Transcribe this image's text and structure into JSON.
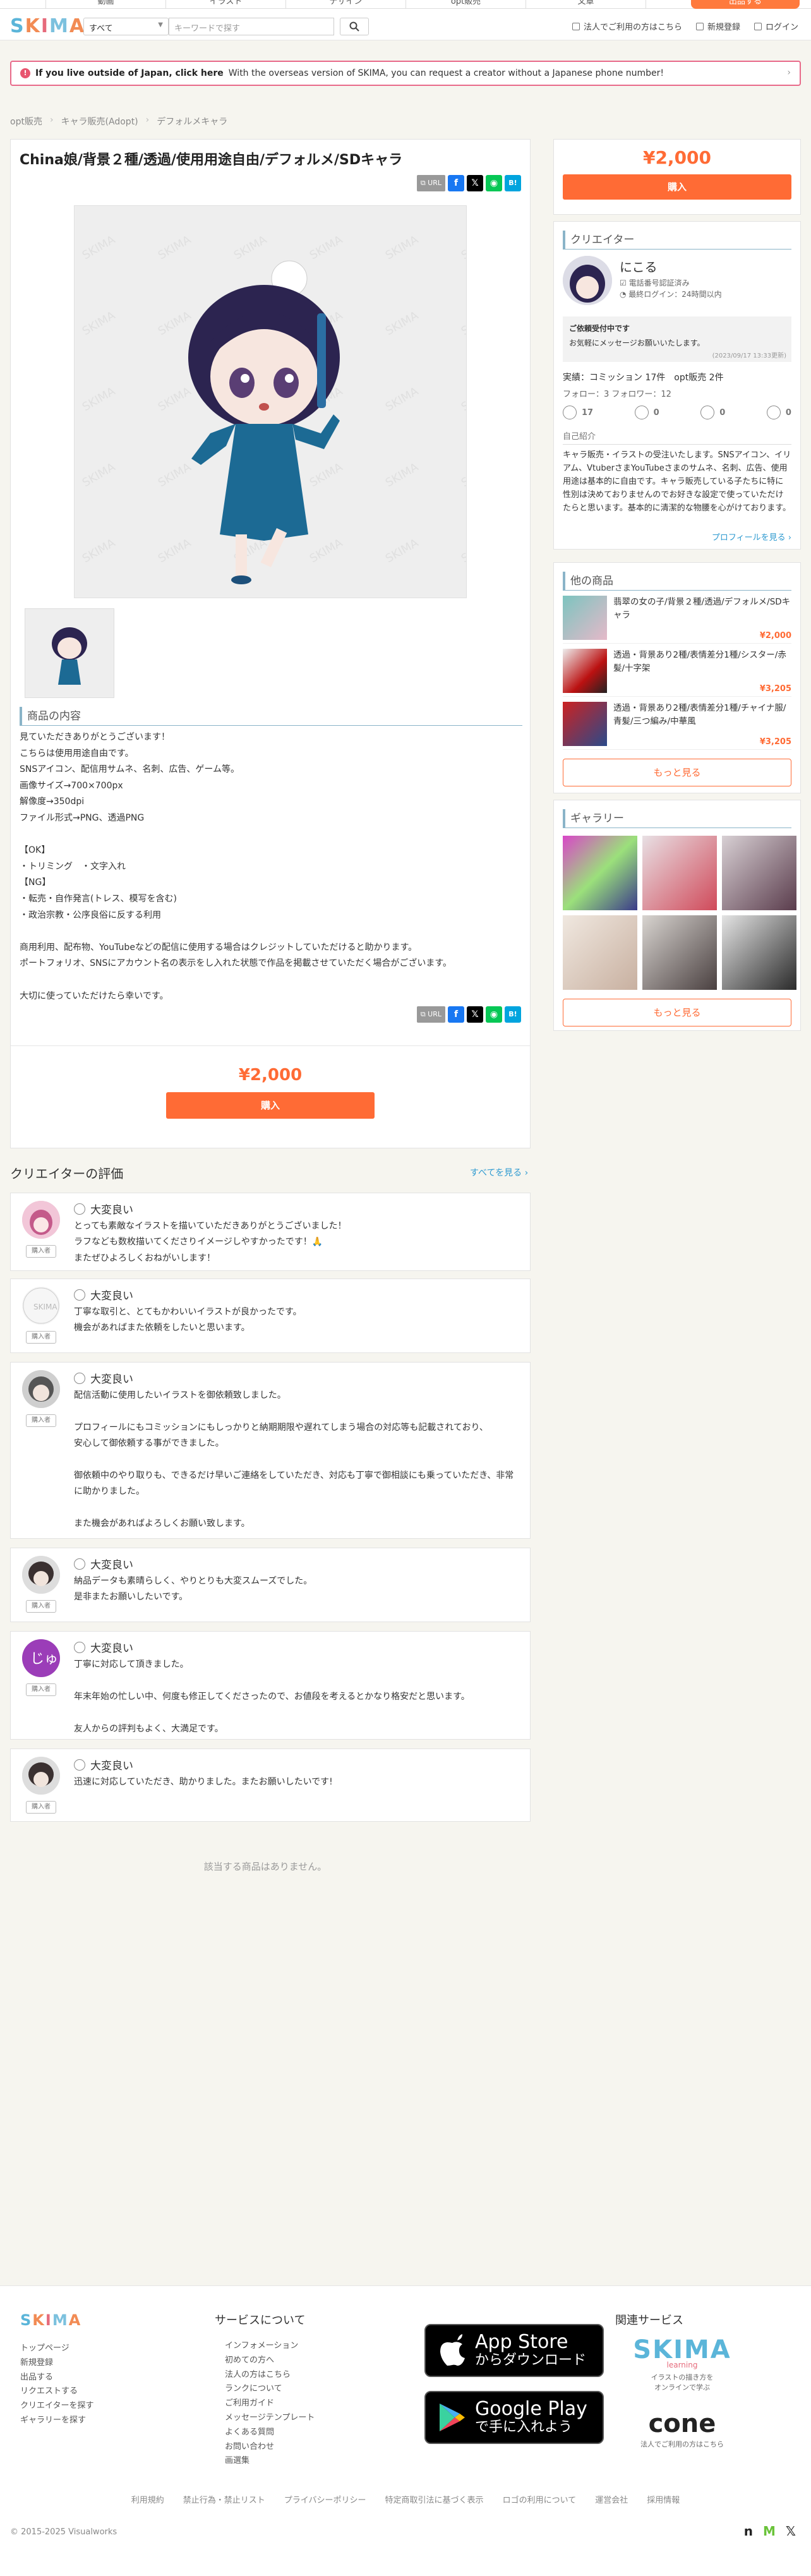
{
  "topnav": {
    "items": [
      "動画",
      "イラスト",
      "デザイン",
      "opt販売",
      "文章",
      "その他"
    ],
    "sell": "出品する"
  },
  "header": {
    "logo": [
      "S",
      "K",
      "I",
      "M",
      "A"
    ],
    "category": "すべて",
    "search_placeholder": "キーワードで探す",
    "links": [
      "法人でご利用の方はこちら",
      "新規登録",
      "ログイン"
    ]
  },
  "alert": {
    "strong": "If you live outside of Japan, click here",
    "text": "With the overseas version of SKIMA, you can request a creator without a Japanese phone number!"
  },
  "breadcrumb": [
    "opt販売",
    "キャラ販売(Adopt)",
    "デフォルメキャラ"
  ],
  "product": {
    "title": "China娘/背景２種/透過/使用用途自由/デフォルメ/SDキャラ",
    "url_label": "URL",
    "content_heading": "商品の内容",
    "description": [
      "見ていただきありがとうございます！",
      "こちらは使用用途自由です。",
      "SNSアイコン、配信用サムネ、名刺、広告、ゲーム等。",
      "画像サイズ→700×700px",
      "解像度→350dpi",
      "ファイル形式→PNG、透過PNG",
      "",
      "【OK】",
      "・トリミング　・文字入れ",
      "【NG】",
      "・転売・自作発言(トレス、模写を含む)",
      "・政治宗教・公序良俗に反する利用",
      "",
      "商用利用、配布物、YouTubeなどの配信に使用する場合はクレジットしていただけると助かります。",
      "ポートフォリオ、SNSにアカウント名の表示をし入れた状態で作品を掲載させていただく場合がございます。",
      "",
      "大切に使っていただけたら幸いです。"
    ],
    "price": "¥2,000",
    "buy": "購入"
  },
  "creator": {
    "heading": "クリエイター",
    "name": "にこる",
    "verified": "電話番号認証済み",
    "last_login": "最終ログイン：24時間以内",
    "accepting": "ご依頼受付中です",
    "accepting_msg": "お気軽にメッセージお願いいたします。",
    "updated": "(2023/09/17 13:33更新)",
    "stats": "実績：コミッション 17件　opt販売 2件",
    "follow": "フォロー：3  フォロワー：12",
    "faces": [
      "17",
      "0",
      "0",
      "0"
    ],
    "intro_heading": "自己紹介",
    "intro": "キャラ販売・イラストの受注いたします。SNSアイコン、イリアム、VtuberさまYouTubeさまのサムネ、名刺、広告、使用用途は基本的に自由です。キャラ販売している子たちに特に性別は決めておりませんのでお好きな設定で使っていただけたらと思います。基本的に清潔的な物腰を心がけております。",
    "profile_link": "プロフィールを見る ›"
  },
  "other_items": {
    "heading": "他の商品",
    "items": [
      {
        "title": "翡翠の女の子/背景２種/透過/デフォルメ/SDキャラ",
        "price": "¥2,000"
      },
      {
        "title": "透過・背景あり2種/表情差分1種/シスター/赤髪/十字架",
        "price": "¥3,205"
      },
      {
        "title": "透過・背景あり2種/表情差分1種/チャイナ服/青髪/三つ編み/中華風",
        "price": "¥3,205"
      }
    ],
    "more": "もっと見る"
  },
  "gallery": {
    "heading": "ギャラリー",
    "more": "もっと見る"
  },
  "reviews": {
    "heading": "クリエイターの評価",
    "all": "すべてを見る ›",
    "tag": "購入者",
    "items": [
      {
        "rating": "大変良い",
        "body": [
          "とっても素敵なイラストを描いていただきありがとうございました！",
          "ラフなども数枚描いてくださりイメージしやすかったです！🙏",
          "またぜひよろしくおねがいします！"
        ]
      },
      {
        "rating": "大変良い",
        "body": [
          "丁寧な取引と、とてもかわいいイラストが良かったです。",
          "機会があればまた依頼をしたいと思います。"
        ]
      },
      {
        "rating": "大変良い",
        "body": [
          "配信活動に使用したいイラストを御依頼致しました。",
          "",
          "プロフィールにもコミッションにもしっかりと納期期限や遅れてしまう場合の対応等も記載されており、",
          "安心して御依頼する事ができました。",
          "",
          "御依頼中のやり取りも、できるだけ早いご連絡をしていただき、対応も丁寧で御相談にも乗っていただき、非常に助かりました。",
          "",
          "また機会があればよろしくお願い致します。"
        ]
      },
      {
        "rating": "大変良い",
        "body": [
          "納品データも素晴らしく、やりとりも大変スムーズでした。",
          "是非またお願いしたいです。"
        ]
      },
      {
        "rating": "大変良い",
        "body": [
          "丁寧に対応して頂きました。",
          "",
          "年末年始の忙しい中、何度も修正してくださったので、お値段を考えるとかなり格安だと思います。",
          "",
          "友人からの評判もよく、大満足です。"
        ]
      },
      {
        "rating": "大変良い",
        "body": [
          "迅速に対応していただき、助かりました。またお願いしたいです!"
        ]
      }
    ]
  },
  "related_empty": "該当する商品はありません。",
  "footer": {
    "col1": [
      "トップページ",
      "新規登録",
      "出品する",
      "リクエストする",
      "クリエイターを探す",
      "ギャラリーを探す"
    ],
    "services_heading": "サービスについて",
    "col2": [
      "インフォメーション",
      "初めての方へ",
      "法人の方はこちら",
      "ランクについて",
      "ご利用ガイド",
      "メッセージテンプレート",
      "よくある質問",
      "お問い合わせ",
      "画選集"
    ],
    "appstore": [
      "App Store",
      "からダウンロード"
    ],
    "googleplay": [
      "Google Play",
      "で手に入れよう"
    ],
    "related_heading": "関連サービス",
    "skima_learning": "learning",
    "skima_learning_sub": [
      "イラストの描き方を",
      "オンラインで学ぶ"
    ],
    "cone": "cone",
    "cone_sub": "法人でご利用の方はこちら",
    "bottom_links": [
      "利用規約",
      "禁止行為・禁止リスト",
      "プライバシーポリシー",
      "特定商取引法に基づく表示",
      "ロゴの利用について",
      "運営会社",
      "採用情報"
    ],
    "copyright": "© 2015-2025 Visualworks"
  },
  "colors": {
    "accent": "#ff6b35",
    "link": "#2e9ad0",
    "heading_rule": "#8ab4c8",
    "alert_border": "#e86a8a"
  }
}
